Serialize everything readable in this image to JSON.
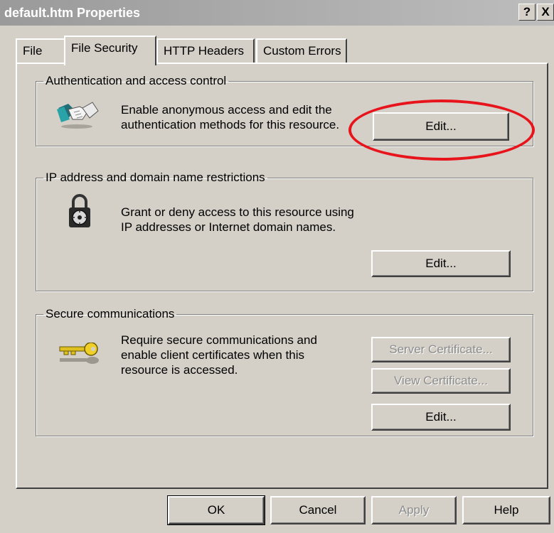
{
  "window": {
    "title": "default.htm Properties",
    "help_glyph": "?",
    "close_glyph": "X"
  },
  "tabs": [
    {
      "label": "File",
      "active": false
    },
    {
      "label": "File Security",
      "active": true
    },
    {
      "label": "HTTP Headers",
      "active": false
    },
    {
      "label": "Custom Errors",
      "active": false
    }
  ],
  "groups": {
    "auth": {
      "legend": "Authentication and access control",
      "icon": "handshake-icon",
      "line1": "Enable anonymous access and edit the",
      "line2": "authentication methods for this resource.",
      "edit_label": "Edit..."
    },
    "ip": {
      "legend": "IP address and domain name restrictions",
      "icon": "padlock-icon",
      "line1": "Grant or deny access to this resource using",
      "line2": "IP addresses or Internet domain names.",
      "edit_label": "Edit..."
    },
    "secure": {
      "legend": "Secure communications",
      "icon": "key-icon",
      "line1": "Require secure communications and",
      "line2": "enable client certificates when this",
      "line3": "resource is accessed.",
      "server_cert_label": "Server Certificate...",
      "view_cert_label": "View Certificate...",
      "edit_label": "Edit..."
    }
  },
  "footer": {
    "ok_label": "OK",
    "cancel_label": "Cancel",
    "apply_label": "Apply",
    "help_label": "Help"
  },
  "colors": {
    "face": "#d4d0c8",
    "highlight_ellipse": "#e8141c",
    "title_gradient_start": "#9a9a9a"
  }
}
